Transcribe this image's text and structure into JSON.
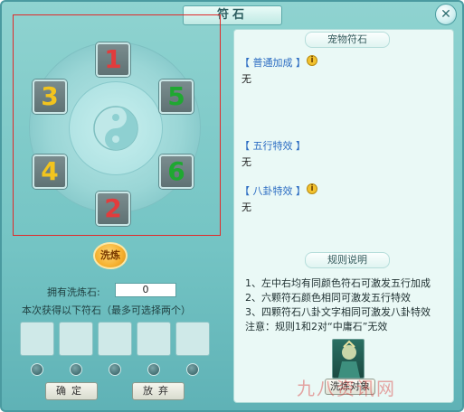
{
  "window": {
    "title": "符石"
  },
  "stones": {
    "top": {
      "label": "1",
      "color": "#e23c3c"
    },
    "left_upper": {
      "label": "3",
      "color": "#f2c41e"
    },
    "right_upper": {
      "label": "5",
      "color": "#1fa831"
    },
    "left_lower": {
      "label": "4",
      "color": "#f2c41e"
    },
    "right_lower": {
      "label": "6",
      "color": "#1fa831"
    },
    "bottom": {
      "label": "2",
      "color": "#e23c3c"
    }
  },
  "left": {
    "wash_button": "洗炼",
    "own_label": "拥有洗炼石:",
    "own_value": "0",
    "gain_label": "本次获得以下符石（最多可选择两个）",
    "confirm": "确定",
    "discard": "放弃"
  },
  "right": {
    "pet_stone_header": "宠物符石",
    "normal_bonus_label": "【 普通加成 】",
    "normal_bonus_value": "无",
    "wuxing_label": "【 五行特效 】",
    "wuxing_value": "无",
    "bagua_label": "【 八卦特效 】",
    "bagua_value": "无",
    "rules_header": "规则说明",
    "rules": [
      "1、左中右均有同颜色符石可激发五行加成",
      "2、六颗符石颜色相同可激发五行特效",
      "3、四颗符石八卦文字相同可激发八卦特效",
      "注意：规则1和2对“中庸石”无效"
    ],
    "pet_button": "洗炼对象"
  },
  "watermark": "九八资讯网",
  "colors": {
    "panel_bg": "#7fcaca",
    "highlight_box": "#e02a2a",
    "label_blue": "#2a6bc2"
  }
}
